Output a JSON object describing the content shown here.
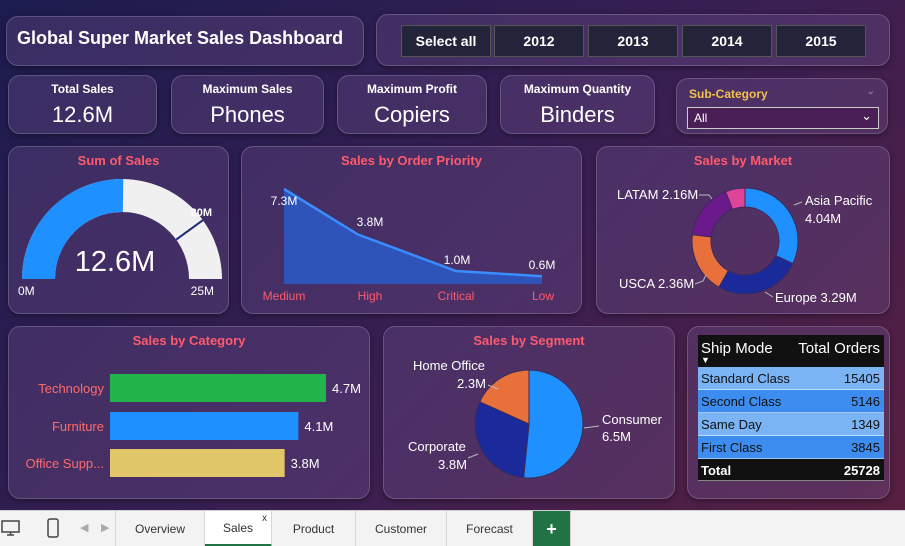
{
  "title": "Global Super Market Sales Dashboard",
  "year_buttons": [
    "Select all",
    "2012",
    "2013",
    "2014",
    "2015"
  ],
  "kpis": [
    {
      "label": "Total Sales",
      "value": "12.6M"
    },
    {
      "label": "Maximum Sales",
      "value": "Phones"
    },
    {
      "label": "Maximum Profit",
      "value": "Copiers"
    },
    {
      "label": "Maximum Quantity",
      "value": "Binders"
    }
  ],
  "subcategory": {
    "label": "Sub-Category",
    "selected": "All"
  },
  "gauge": {
    "title": "Sum of Sales",
    "value": 12.6,
    "value_label": "12.6M",
    "min_label": "0M",
    "max_label": "25M",
    "target_label": "20M",
    "min": 0,
    "max": 25,
    "target": 20
  },
  "order_priority": {
    "title": "Sales by Order Priority",
    "categories": [
      "Medium",
      "High",
      "Critical",
      "Low"
    ],
    "values": [
      7.3,
      3.8,
      1.0,
      0.6
    ],
    "labels": [
      "7.3M",
      "3.8M",
      "1.0M",
      "0.6M"
    ]
  },
  "market": {
    "title": "Sales by Market",
    "slices": [
      {
        "name": "Asia Pacific",
        "value": 4.04,
        "label": "4.04M",
        "color": "#1e90ff"
      },
      {
        "name": "Europe",
        "value": 3.29,
        "label": "3.29M",
        "color": "#1a2a9a"
      },
      {
        "name": "USCA",
        "value": 2.36,
        "label": "2.36M",
        "color": "#e8703a"
      },
      {
        "name": "LATAM",
        "value": 2.16,
        "label": "2.16M",
        "color": "#6a1a8a"
      },
      {
        "name": "",
        "value": 0.75,
        "label": "",
        "color": "#e0449a"
      }
    ],
    "callouts": {
      "latam": "LATAM 2.16M",
      "asia_name": "Asia Pacific",
      "asia_value": "4.04M",
      "usca": "USCA 2.36M",
      "europe": "Europe 3.29M"
    }
  },
  "category": {
    "title": "Sales by Category",
    "items": [
      {
        "name": "Technology",
        "value": 4.7,
        "label": "4.7M",
        "color": "#22b34a"
      },
      {
        "name": "Furniture",
        "value": 4.1,
        "label": "4.1M",
        "color": "#1e90ff"
      },
      {
        "name": "Office Supp...",
        "value": 3.8,
        "label": "3.8M",
        "color": "#e2c66a"
      }
    ]
  },
  "segment": {
    "title": "Sales by Segment",
    "slices": [
      {
        "name": "Consumer",
        "value": 6.5,
        "label": "6.5M",
        "color": "#1e90ff"
      },
      {
        "name": "Corporate",
        "value": 3.8,
        "label": "3.8M",
        "color": "#1a2a9a"
      },
      {
        "name": "Home Office",
        "value": 2.3,
        "label": "2.3M",
        "color": "#e8703a"
      }
    ]
  },
  "ship_table": {
    "headers": [
      "Ship Mode",
      "Total Orders"
    ],
    "rows": [
      {
        "mode": "Standard Class",
        "orders": "15405"
      },
      {
        "mode": "Second Class",
        "orders": "5146"
      },
      {
        "mode": "Same Day",
        "orders": "1349"
      },
      {
        "mode": "First Class",
        "orders": "3845"
      }
    ],
    "total": {
      "label": "Total",
      "value": "25728"
    }
  },
  "sheet_tabs": [
    "Overview",
    "Sales",
    "Product",
    "Customer",
    "Forecast"
  ],
  "active_tab": "Sales",
  "add_tab": "+",
  "close_tab": "x",
  "colors": {
    "title_accent": "#ff5a6e",
    "subcat_label": "#f2c14e",
    "excel_green": "#217346"
  }
}
